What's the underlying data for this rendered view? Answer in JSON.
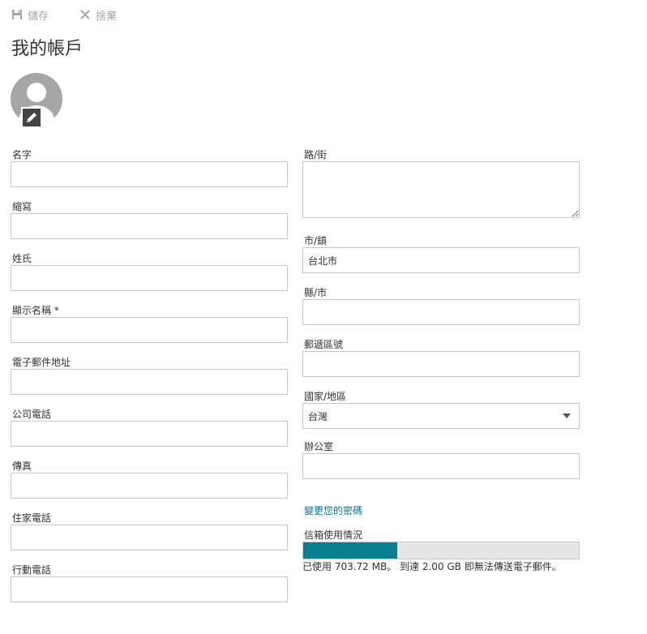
{
  "toolbar": {
    "save_label": "儲存",
    "discard_label": "捨棄",
    "save_icon": "floppy-disk-icon",
    "discard_icon": "close-icon"
  },
  "page_title": "我的帳戶",
  "avatar": {
    "icon": "person-icon",
    "edit_icon": "pencil-icon"
  },
  "left_fields": {
    "first_name": {
      "label": "名字",
      "value": ""
    },
    "initials": {
      "label": "縮寫",
      "value": ""
    },
    "last_name": {
      "label": "姓氏",
      "value": ""
    },
    "display_name": {
      "label": "顯示名稱",
      "required_mark": "*",
      "value": ""
    },
    "email": {
      "label": "電子郵件地址",
      "value": ""
    },
    "work_phone": {
      "label": "公司電話",
      "value": ""
    },
    "fax": {
      "label": "傳真",
      "value": ""
    },
    "home_phone": {
      "label": "住家電話",
      "value": ""
    },
    "mobile_phone": {
      "label": "行動電話",
      "value": ""
    }
  },
  "right_fields": {
    "street": {
      "label": "路/街",
      "value": ""
    },
    "city": {
      "label": "市/鎮",
      "value": "台北市"
    },
    "state": {
      "label": "縣/市",
      "value": ""
    },
    "postal_code": {
      "label": "郵遞區號",
      "value": ""
    },
    "country": {
      "label": "國家/地區",
      "value": "台灣"
    },
    "office": {
      "label": "辦公室",
      "value": ""
    }
  },
  "change_password_link": "變更您的密碼",
  "mailbox": {
    "label": "信箱使用情況",
    "used_fraction": 0.34,
    "usage_text": "已使用 703.72 MB。 到達 2.00 GB 即無法傳送電子郵件。",
    "bar_color": "#0b7f90"
  }
}
